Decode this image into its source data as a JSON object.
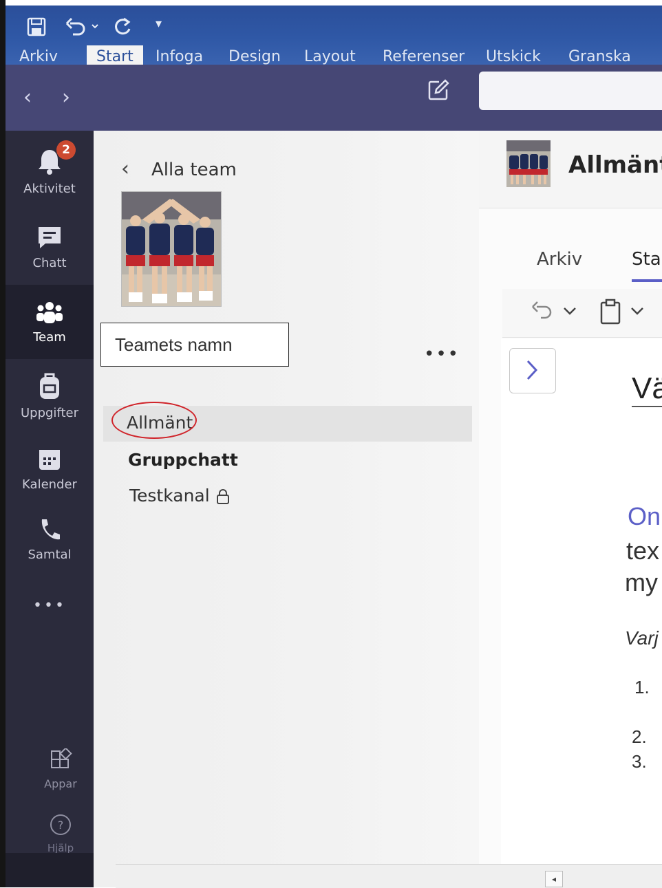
{
  "word": {
    "tabs": [
      "Arkiv",
      "Start",
      "Infoga",
      "Design",
      "Layout",
      "Referenser",
      "Utskick",
      "Granska"
    ],
    "active_tab": "Start"
  },
  "teams": {
    "rail": {
      "activity": {
        "label": "Aktivitet",
        "badge": "2"
      },
      "chat": {
        "label": "Chatt"
      },
      "teams": {
        "label": "Team"
      },
      "assignments": {
        "label": "Uppgifter"
      },
      "calendar": {
        "label": "Kalender"
      },
      "calls": {
        "label": "Samtal"
      },
      "more": "•••",
      "apps": {
        "label": "Appar"
      },
      "help": {
        "label": "Hjälp"
      }
    },
    "panel": {
      "back_label": "Alla team",
      "team_name": "Teamets namn",
      "more": "•••",
      "channels": [
        {
          "name": "Allmänt"
        },
        {
          "name": "Gruppchatt"
        },
        {
          "name": "Testkanal"
        }
      ]
    },
    "content": {
      "title": "Allmänt",
      "ribbon_tabs": [
        "Arkiv",
        "Start"
      ],
      "active_ribbon_tab": "Start",
      "doc_heading": "Vä",
      "doc_lines": [
        "On",
        "tex",
        "my"
      ],
      "doc_italic": "Varj",
      "list_numbers": [
        "1.",
        "2.",
        "3."
      ]
    },
    "colors": {
      "topbar": "#464775",
      "rail": "#2b2b3c",
      "accent": "#5b5fc7",
      "badge": "#cc4a31",
      "annotation": "#d0242a"
    }
  }
}
